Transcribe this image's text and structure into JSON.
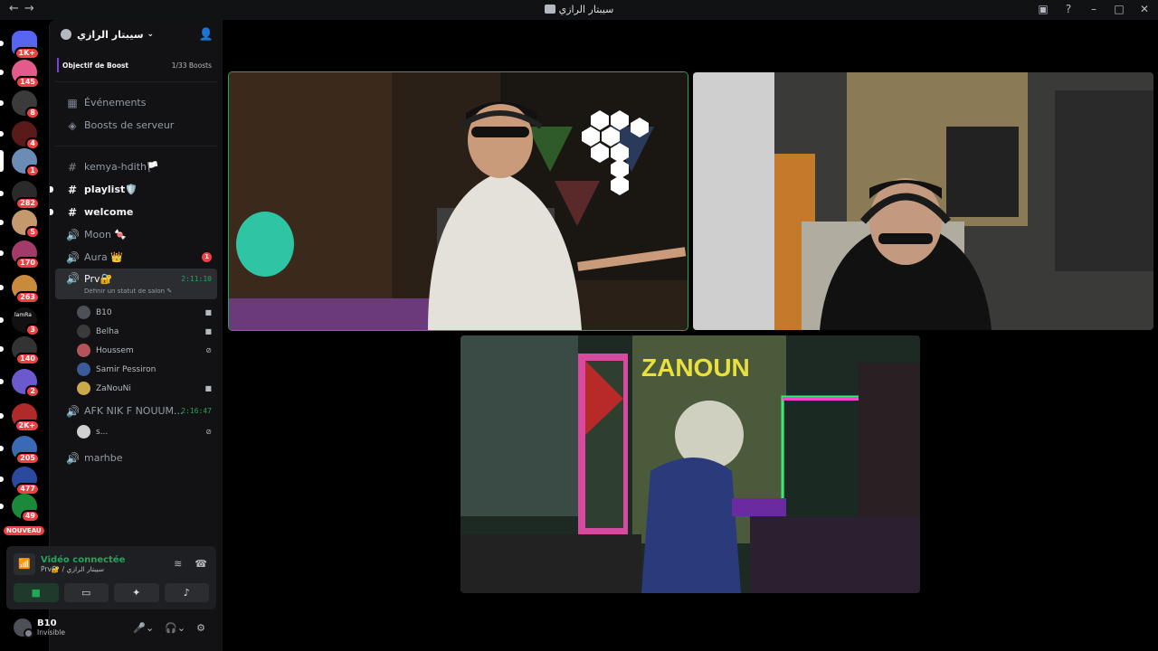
{
  "window": {
    "title": "سيبتار الرازي"
  },
  "guilds": [
    {
      "name": "discord-home",
      "color": "#5865f2",
      "badge": "1K+"
    },
    {
      "name": "server-1",
      "color": "#e35a8c",
      "badge": "145"
    },
    {
      "name": "server-2",
      "color": "#3b3b3b",
      "badge": "8"
    },
    {
      "name": "server-3",
      "color": "#5a1a1a",
      "badge": "4"
    },
    {
      "name": "server-4",
      "color": "#6b8db5",
      "badge": "1",
      "selected": true
    },
    {
      "name": "server-5",
      "color": "#2a2a2a",
      "badge": "282"
    },
    {
      "name": "server-6",
      "color": "#c49a6c",
      "badge": "5"
    },
    {
      "name": "server-7",
      "color": "#a23b6a",
      "badge": "170"
    },
    {
      "name": "server-8",
      "color": "#c98a3a",
      "badge": "263"
    },
    {
      "name": "server-9",
      "color": "#111111",
      "badge": "3"
    },
    {
      "name": "server-10",
      "color": "#333333",
      "badge": "140"
    },
    {
      "name": "server-11",
      "color": "#6a5acd",
      "badge": "2"
    },
    {
      "name": "server-12",
      "color": "#b02a2a",
      "badge": "2K+"
    },
    {
      "name": "server-13",
      "color": "#3a6ab5",
      "badge": "205"
    },
    {
      "name": "server-14",
      "color": "#2a4aa0",
      "badge": "477"
    },
    {
      "name": "server-15",
      "color": "#1a8a3a",
      "badge": "49"
    }
  ],
  "guild_labels": {
    "nouveau": "NOUVEAU",
    "text_icon_9": "lamRa"
  },
  "server": {
    "name": "سيبتار الرازي",
    "boost_label": "Objectif de Boost",
    "boost_count": "1/33 Boosts"
  },
  "menu": {
    "events": "Événements",
    "boosts": "Boosts de serveur"
  },
  "channels": {
    "kemya": "kemya-hdith🏳️",
    "playlist": "playlist🛡️",
    "welcome": "welcome",
    "moon": "Moon 🍬",
    "aura": "Aura 👑",
    "aura_mentions": "1",
    "prv": "Prv🔐",
    "prv_timer": "2:11:10",
    "prv_status": "Définir un statut de salon",
    "afk": "AFK NIK F NOUUM...",
    "afk_timer": "2:16:47",
    "marhbe": "marhbe"
  },
  "prv_users": [
    {
      "name": "B10",
      "status": "video",
      "color": "#4e5058"
    },
    {
      "name": "Belha",
      "status": "video",
      "color": "#3a3a3a"
    },
    {
      "name": "Houssem",
      "status": "deafened",
      "color": "#b5535a"
    },
    {
      "name": "Samir Pessiron",
      "status": "",
      "color": "#3a5a9a"
    },
    {
      "name": "ZaNouNi",
      "status": "video",
      "color": "#c9a94a"
    }
  ],
  "afk_users": [
    {
      "name": "s...",
      "status": "deafened",
      "color": "#d0d0d0"
    }
  ],
  "voice": {
    "connected": "Vidéo connectée",
    "location": "Prv🔐 / سيبتار الرازي"
  },
  "me": {
    "name": "B10",
    "status": "Invisible"
  }
}
